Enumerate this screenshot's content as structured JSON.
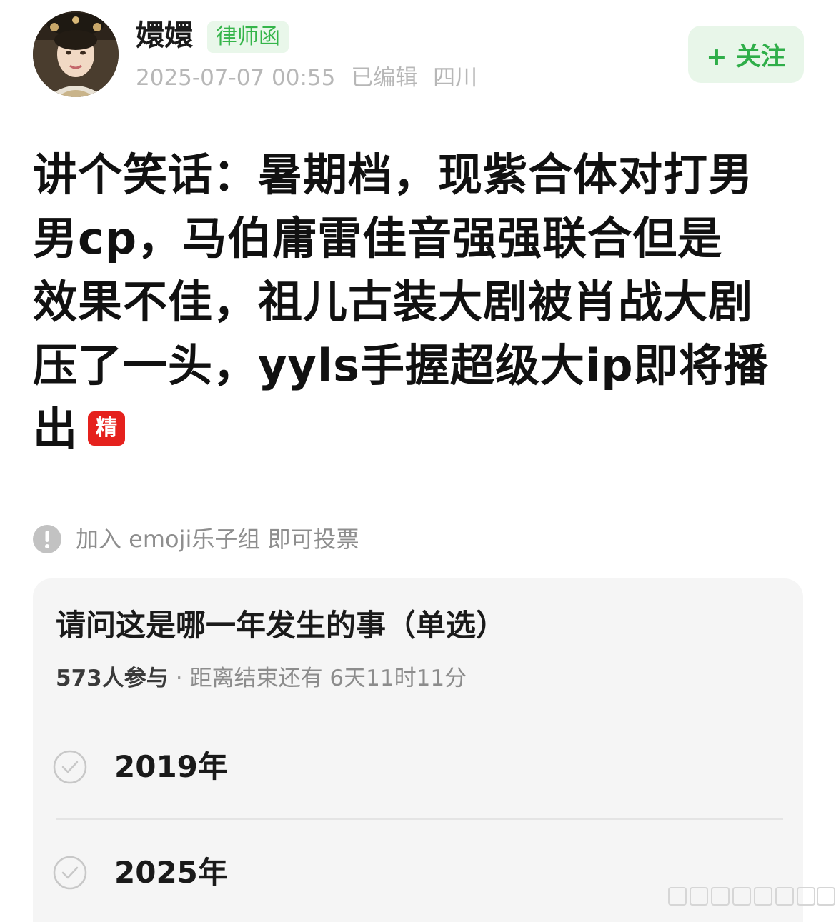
{
  "header": {
    "username": "嬛嬛",
    "badge": "律师函",
    "timestamp": "2025-07-07 00:55",
    "edited": "已编辑",
    "location": "四川",
    "follow_label": "+ 关注"
  },
  "post": {
    "lines": [
      "讲个笑话：暑期档，现紫合体对打男",
      "男cp，马伯庸雷佳音强强联合但是",
      "效果不佳，祖儿古装大剧被肖战大剧",
      "压了一头，yyls手握超级大ip即将播",
      "出"
    ],
    "featured_badge": "精"
  },
  "vote_notice": {
    "text": "加入 emoji乐子组 即可投票",
    "icon": "exclamation-circle-icon"
  },
  "poll": {
    "question": "请问这是哪一年发生的事（单选）",
    "participants": "573人参与",
    "separator": "·",
    "deadline": "距离结束还有 6天11时11分",
    "options": [
      {
        "label": "2019年",
        "icon": "check-circle-icon"
      },
      {
        "label": "2025年",
        "icon": "check-circle-icon"
      }
    ]
  },
  "colors": {
    "accent_green": "#2fae49",
    "badge_green_bg": "#e9f7ea",
    "featured_red": "#e5211d",
    "meta_gray": "#b7b7b7",
    "card_bg": "#f5f5f5"
  }
}
